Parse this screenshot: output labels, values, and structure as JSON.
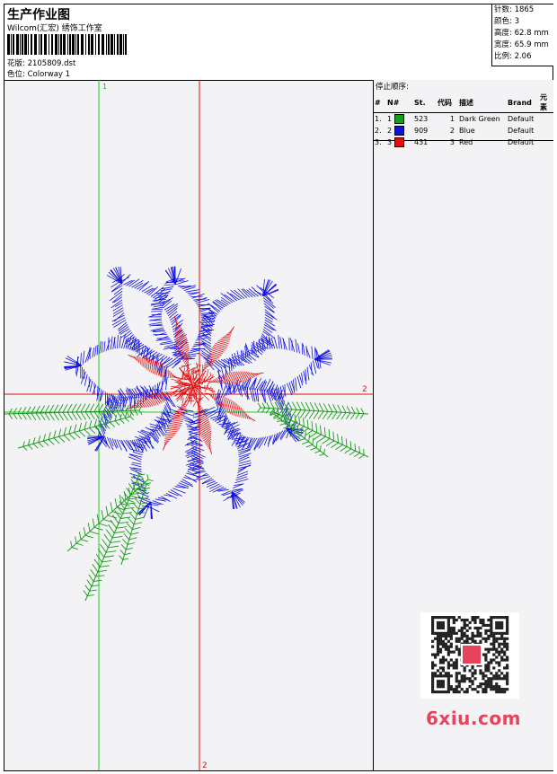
{
  "header": {
    "title": "生产作业图",
    "subtitle": "Wilcom(汇宏) 绣饰工作室",
    "design_label": "花版: 2105809.dst",
    "colorway_label": "色位: Colorway 1"
  },
  "stats": [
    {
      "label": "针数: 1865"
    },
    {
      "label": "颜色: 3"
    },
    {
      "label": "高度: 62.8 mm"
    },
    {
      "label": "宽度: 65.9 mm"
    },
    {
      "label": "比例: 2.06"
    }
  ],
  "stop_sequence": {
    "title": "停止顺序:",
    "headers": [
      "#",
      "N#",
      "St.",
      "代码",
      "描述",
      "Brand",
      "元素"
    ],
    "rows": [
      {
        "index": "1.",
        "n": "1",
        "color": "#1a9b1a",
        "stitches": "523",
        "code": "1",
        "desc": "Dark Green",
        "brand": "Default",
        "element": ""
      },
      {
        "index": "2.",
        "n": "2",
        "color": "#1010e0",
        "stitches": "909",
        "code": "2",
        "desc": "Blue",
        "brand": "Default",
        "element": ""
      },
      {
        "index": "3.",
        "n": "3",
        "color": "#e01010",
        "stitches": "431",
        "code": "3",
        "desc": "Red",
        "brand": "Default",
        "element": ""
      }
    ]
  },
  "guides": {
    "green_label": "1",
    "red_label_right": "2",
    "red_label_bottom": "2"
  },
  "colors": {
    "green": "#1a9b1a",
    "blue": "#1010e0",
    "red": "#e01010",
    "guide_green": "#22cc22",
    "guide_red": "#e01010"
  },
  "watermark": {
    "text": "6xiu.com"
  }
}
